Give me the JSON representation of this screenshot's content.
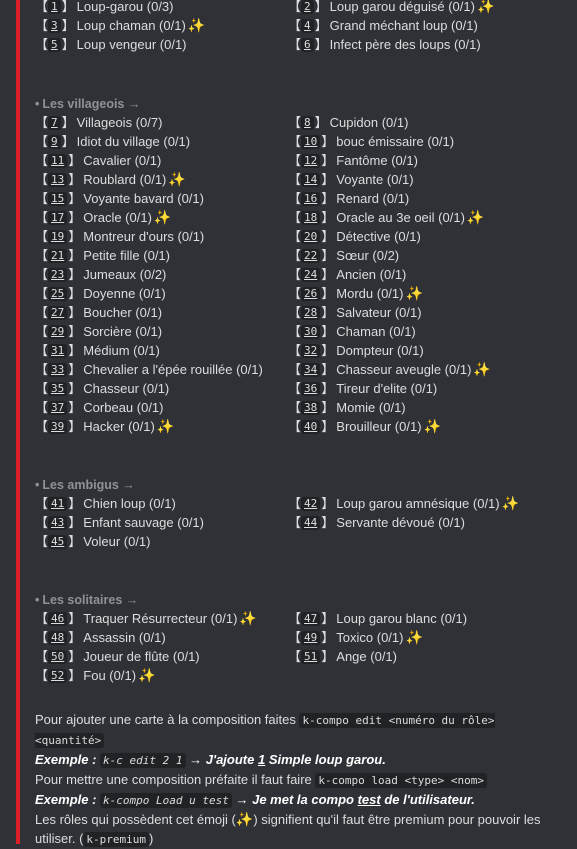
{
  "top": [
    [
      {
        "n": "1",
        "label": "Loup-garou (0/3)"
      },
      {
        "n": "2",
        "label": "Loup garou déguisé (0/1)",
        "premium": true
      }
    ],
    [
      {
        "n": "3",
        "label": "Loup chaman (0/1)",
        "premium": true
      },
      {
        "n": "4",
        "label": "Grand méchant loup (0/1)"
      }
    ],
    [
      {
        "n": "5",
        "label": "Loup vengeur (0/1)"
      },
      {
        "n": "6",
        "label": "Infect père des loups (0/1)"
      }
    ]
  ],
  "sections": [
    {
      "title": "Les villageois →",
      "rows": [
        [
          {
            "n": "7",
            "label": "Villageois (0/7)"
          },
          {
            "n": "8",
            "label": "Cupidon (0/1)"
          }
        ],
        [
          {
            "n": "9",
            "label": "Idiot du village (0/1)"
          },
          {
            "n": "10",
            "label": "bouc émissaire (0/1)"
          }
        ],
        [
          {
            "n": "11",
            "label": "Cavalier (0/1)"
          },
          {
            "n": "12",
            "label": "Fantôme (0/1)"
          }
        ],
        [
          {
            "n": "13",
            "label": "Roublard (0/1)",
            "premium": true
          },
          {
            "n": "14",
            "label": "Voyante (0/1)"
          }
        ],
        [
          {
            "n": "15",
            "label": "Voyante bavard (0/1)"
          },
          {
            "n": "16",
            "label": "Renard (0/1)"
          }
        ],
        [
          {
            "n": "17",
            "label": "Oracle (0/1)",
            "premium": true
          },
          {
            "n": "18",
            "label": "Oracle au 3e oeil (0/1)",
            "premium": true
          }
        ],
        [
          {
            "n": "19",
            "label": "Montreur d'ours (0/1)"
          },
          {
            "n": "20",
            "label": "Détective (0/1)"
          }
        ],
        [
          {
            "n": "21",
            "label": "Petite fille (0/1)"
          },
          {
            "n": "22",
            "label": "Sœur (0/2)"
          }
        ],
        [
          {
            "n": "23",
            "label": "Jumeaux (0/2)"
          },
          {
            "n": "24",
            "label": "Ancien (0/1)"
          }
        ],
        [
          {
            "n": "25",
            "label": "Doyenne (0/1)"
          },
          {
            "n": "26",
            "label": "Mordu (0/1)",
            "premium": true
          }
        ],
        [
          {
            "n": "27",
            "label": "Boucher (0/1)"
          },
          {
            "n": "28",
            "label": "Salvateur (0/1)"
          }
        ],
        [
          {
            "n": "29",
            "label": "Sorcière (0/1)"
          },
          {
            "n": "30",
            "label": "Chaman (0/1)"
          }
        ],
        [
          {
            "n": "31",
            "label": "Médium (0/1)"
          },
          {
            "n": "32",
            "label": "Dompteur (0/1)"
          }
        ],
        [
          {
            "n": "33",
            "label": "Chevalier a l'épée rouillée (0/1)"
          },
          {
            "n": "34",
            "label": "Chasseur aveugle (0/1)",
            "premium": true
          }
        ],
        [
          {
            "n": "35",
            "label": "Chasseur (0/1)"
          },
          {
            "n": "36",
            "label": "Tireur d'elite (0/1)"
          }
        ],
        [
          {
            "n": "37",
            "label": "Corbeau (0/1)"
          },
          {
            "n": "38",
            "label": "Momie (0/1)"
          }
        ],
        [
          {
            "n": "39",
            "label": "Hacker (0/1)",
            "premium": true
          },
          {
            "n": "40",
            "label": "Brouilleur (0/1)",
            "premium": true
          }
        ]
      ]
    },
    {
      "title": "Les ambigus →",
      "rows": [
        [
          {
            "n": "41",
            "label": "Chien loup (0/1)"
          },
          {
            "n": "42",
            "label": "Loup garou amnésique (0/1)",
            "premium": true
          }
        ],
        [
          {
            "n": "43",
            "label": "Enfant sauvage (0/1)"
          },
          {
            "n": "44",
            "label": "Servante dévoué (0/1)"
          }
        ],
        [
          {
            "n": "45",
            "label": "Voleur (0/1)"
          },
          null
        ]
      ]
    },
    {
      "title": "Les solitaires →",
      "rows": [
        [
          {
            "n": "46",
            "label": "Traquer Résurrecteur (0/1)",
            "premium": true
          },
          {
            "n": "47",
            "label": "Loup garou blanc (0/1)"
          }
        ],
        [
          {
            "n": "48",
            "label": "Assassin (0/1)"
          },
          {
            "n": "49",
            "label": "Toxico (0/1)",
            "premium": true
          }
        ],
        [
          {
            "n": "50",
            "label": "Joueur de flûte (0/1)"
          },
          {
            "n": "51",
            "label": "Ange (0/1)"
          }
        ],
        [
          {
            "n": "52",
            "label": "Fou (0/1)",
            "premium": true
          },
          null
        ]
      ]
    }
  ],
  "footer": {
    "line1_text": "Pour ajouter une carte à la composition faites ",
    "line1_code": "k-compo edit <numéro du rôle> <quantité>",
    "ex1_label": "Exemple : ",
    "ex1_code": "k-c edit 2 1",
    "ex1_arrow": " → ",
    "ex1_a": "J'ajoute ",
    "ex1_u": "1",
    "ex1_b": " Simple loup garou.",
    "line2_text": "Pour mettre une composition préfaite il faut faire ",
    "line2_code": "k-compo load <type> <nom>",
    "ex2_label": "Exemple : ",
    "ex2_code": "k-compo Load u test",
    "ex2_arrow": " → ",
    "ex2_a": "Je met la compo ",
    "ex2_u": "test",
    "ex2_b": " de l'utilisateur.",
    "line3_a": "Les rôles qui possèdent cet émoji (",
    "line3_b": ") signifient qu'il faut être premium pour pouvoir les utiliser. (",
    "line3_code": "k-premium",
    "line3_c": ")"
  },
  "icons": {
    "premium": "sparkles-icon"
  },
  "colors": {
    "accent": "#dd1e27",
    "background": "#2f3136",
    "sparkle": "#f5c518"
  }
}
